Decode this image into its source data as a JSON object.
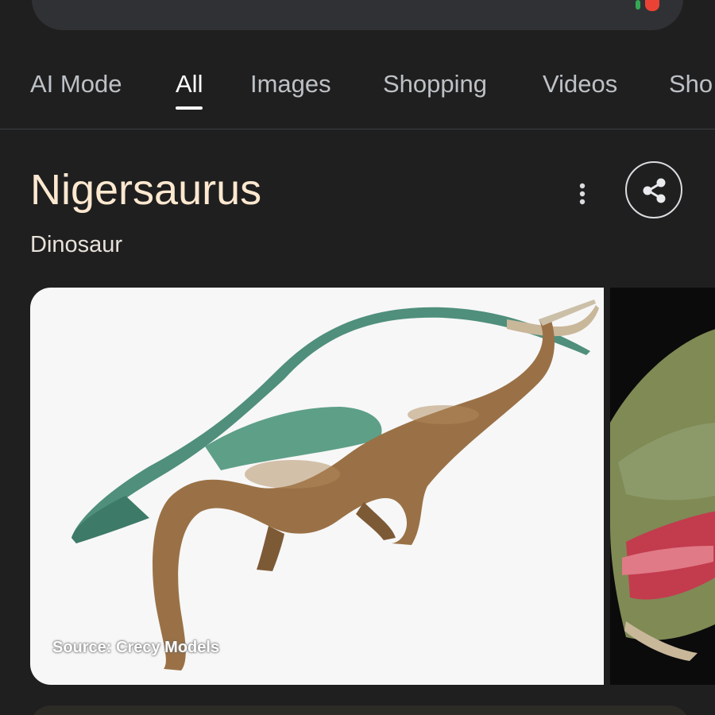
{
  "tabs": [
    {
      "label": "AI Mode"
    },
    {
      "label": "All"
    },
    {
      "label": "Images"
    },
    {
      "label": "Shopping"
    },
    {
      "label": "Videos"
    },
    {
      "label": "Sho"
    }
  ],
  "entity": {
    "title": "Nigersaurus",
    "subtitle": "Dinosaur"
  },
  "images": {
    "main_source": "Source: Crecy Models"
  },
  "colors": {
    "background": "#1f1f1f",
    "title": "#fde8d0",
    "tab_active": "#ffffff",
    "tab_inactive": "#bdc1c6"
  },
  "icons": {
    "more": "more-vert-icon",
    "share": "share-icon"
  }
}
